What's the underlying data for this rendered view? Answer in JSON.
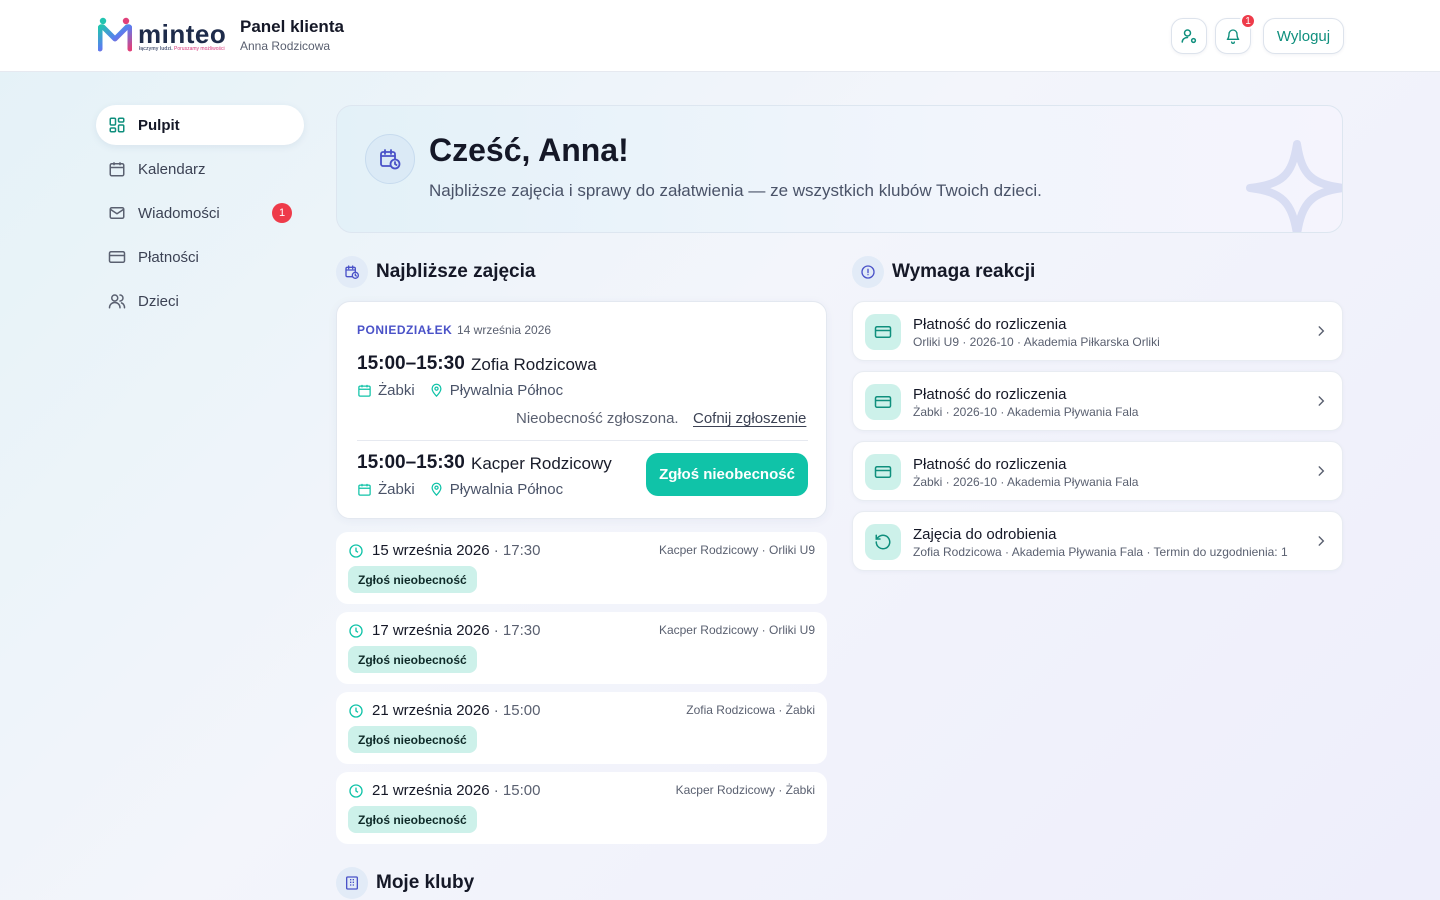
{
  "header": {
    "logo_word": "minteo",
    "logo_tag_1": "łączymy ludzi.",
    "logo_tag_2": "Poruszamy możliwości",
    "title": "Panel klienta",
    "subtitle": "Anna Rodzicowa",
    "notifications_count": "1",
    "logout_label": "Wyloguj"
  },
  "sidebar": {
    "items": [
      {
        "label": "Pulpit",
        "icon": "dashboard-icon",
        "active": true
      },
      {
        "label": "Kalendarz",
        "icon": "calendar-icon"
      },
      {
        "label": "Wiadomości",
        "icon": "mail-icon",
        "badge": "1"
      },
      {
        "label": "Płatności",
        "icon": "credit-card-icon"
      },
      {
        "label": "Dzieci",
        "icon": "users-icon"
      }
    ]
  },
  "hero": {
    "title": "Cześć, Anna!",
    "subtitle": "Najbliższe zajęcia i sprawy do załatwienia — ze wszystkich klubów Twoich dzieci."
  },
  "upcoming": {
    "title": "Najbliższe zajęcia",
    "main": {
      "day": "PONIEDZIAŁEK",
      "date": "14 września 2026",
      "sessions": [
        {
          "time": "15:00–15:30",
          "name": "Zofia Rodzicowa",
          "place": "Żabki",
          "venue": "Pływalnia Północ",
          "absence_note": "Nieobecność zgłoszona.",
          "undo_label": "Cofnij zgłoszenie"
        },
        {
          "time": "15:00–15:30",
          "name": "Kacper Rodzicowy",
          "place": "Żabki",
          "venue": "Pływalnia Północ",
          "button_label": "Zgłoś nieobecność"
        }
      ]
    },
    "items": [
      {
        "date": "15 września 2026",
        "time": " · 17:30",
        "info": "Kacper Rodzicowy · Orliki U9",
        "button_label": "Zgłoś nieobecność"
      },
      {
        "date": "17 września 2026",
        "time": " · 17:30",
        "info": "Kacper Rodzicowy · Orliki U9",
        "button_label": "Zgłoś nieobecność"
      },
      {
        "date": "21 września 2026",
        "time": " · 15:00",
        "info": "Zofia Rodzicowa · Żabki",
        "button_label": "Zgłoś nieobecność"
      },
      {
        "date": "21 września 2026",
        "time": " · 15:00",
        "info": "Kacper Rodzicowy · Żabki",
        "button_label": "Zgłoś nieobecność"
      }
    ]
  },
  "actions": {
    "title": "Wymaga reakcji",
    "items": [
      {
        "icon": "credit-card-icon",
        "title": "Płatność do rozliczenia",
        "subtitle": "Orliki U9 · 2026-10 · Akademia Piłkarska Orliki"
      },
      {
        "icon": "credit-card-icon",
        "title": "Płatność do rozliczenia",
        "subtitle": "Żabki · 2026-10 · Akademia Pływania Fala"
      },
      {
        "icon": "credit-card-icon",
        "title": "Płatność do rozliczenia",
        "subtitle": "Żabki · 2026-10 · Akademia Pływania Fala"
      },
      {
        "icon": "refresh-icon",
        "title": "Zajęcia do odrobienia",
        "subtitle": "Zofia Rodzicowa · Akademia Pływania Fala · Termin do uzgodnienia: 1"
      }
    ]
  },
  "clubs": {
    "title": "Moje kluby"
  },
  "colors": {
    "accent": "#10c3a8",
    "badge": "#ee3b4a",
    "day_label": "#4a52c8"
  }
}
